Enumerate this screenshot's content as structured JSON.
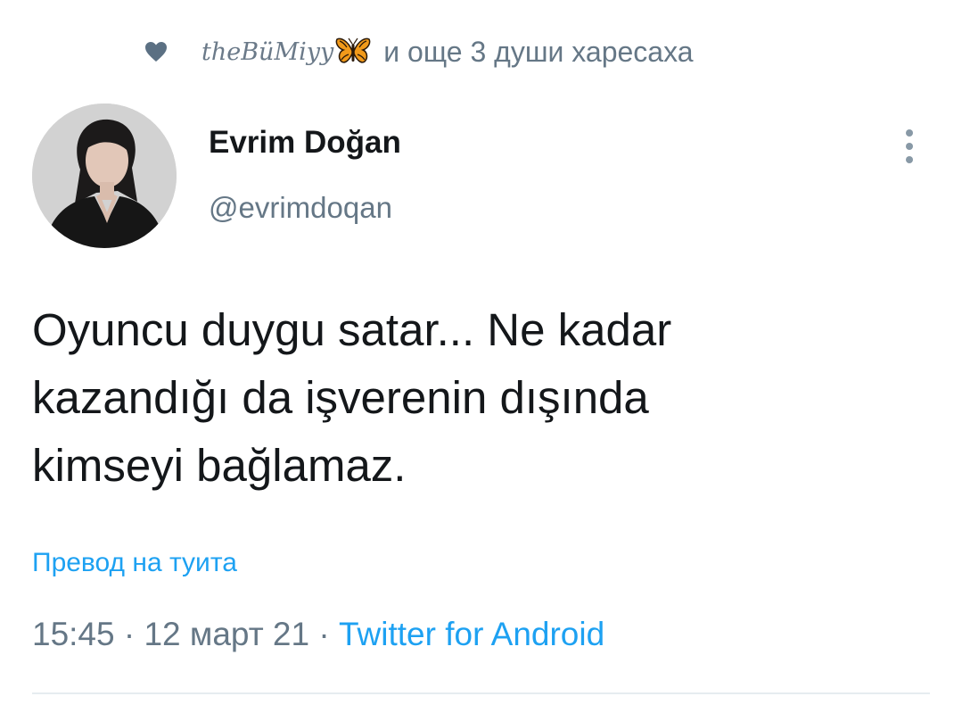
{
  "social_context": {
    "icon": "heart-icon",
    "liker_name": "theBüMiyy",
    "liker_emoji": "butterfly-icon",
    "suffix": "и още 3 души харесаха"
  },
  "author": {
    "name": "Evrim Doğan",
    "handle": "@evrimdoqan"
  },
  "tweet": {
    "lines": [
      "Oyuncu duygu satar... Ne kadar",
      "kazandığı da işverenin dışında",
      "kimseyi bağlamaz."
    ]
  },
  "translate_label": "Превод на туита",
  "meta": {
    "time": "15:45",
    "separator": "·",
    "date": "12 март 21",
    "source": "Twitter for Android"
  },
  "colors": {
    "link": "#1da1f2",
    "secondary_text": "#657786",
    "primary_text": "#14171a",
    "heart": "#5b7083"
  }
}
